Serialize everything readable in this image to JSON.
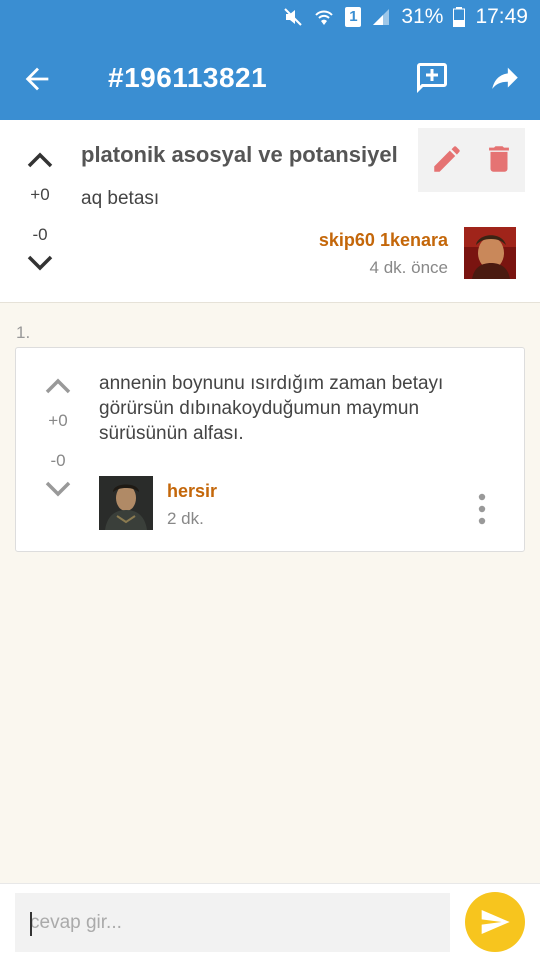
{
  "status_bar": {
    "battery": "31%",
    "time": "17:49",
    "sim": "1"
  },
  "app_bar": {
    "title": "#196113821"
  },
  "entry": {
    "title": "platonik asosyal ve potansiyel",
    "body": "aq betası",
    "upvotes": "+0",
    "downvotes": "-0",
    "author": "skip60 1kenara",
    "time": "4 dk. önce"
  },
  "replies": [
    {
      "number": "1.",
      "body": "annenin boynunu ısırdığım zaman betayı görürsün dıbınakoyduğumun maymun sürüsünün alfası.",
      "upvotes": "+0",
      "downvotes": "-0",
      "author": "hersir",
      "time": "2 dk."
    }
  ],
  "input": {
    "placeholder": "cevap gir..."
  },
  "colors": {
    "primary": "#3a8ed2",
    "accent_author": "#c4670a",
    "send_button": "#f7c51e",
    "action_icons": "#e57373",
    "background": "#faf7ef"
  },
  "icons": {
    "back": "arrow-left-icon",
    "add_comment": "add-comment-icon",
    "share": "share-icon",
    "edit": "pencil-icon",
    "delete": "trash-icon",
    "upvote": "chevron-up-icon",
    "downvote": "chevron-down-icon",
    "more": "more-vertical-icon",
    "send": "send-icon"
  }
}
